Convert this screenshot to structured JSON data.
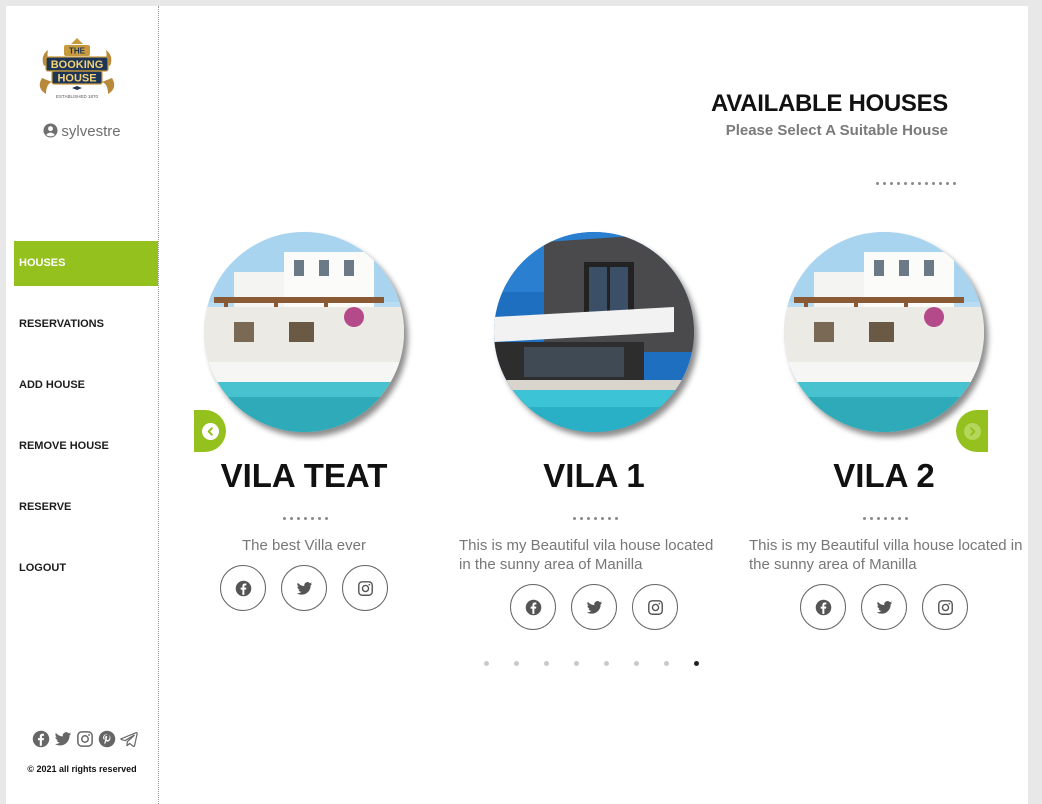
{
  "brand": {
    "logo_lines": [
      "THE",
      "BOOKING",
      "HOUSE",
      "ESTABLISHED 1870"
    ]
  },
  "user": {
    "name": "sylvestre",
    "icon": "user-circle-icon"
  },
  "nav": {
    "items": [
      {
        "label": "HOUSES",
        "active": true
      },
      {
        "label": "RESERVATIONS",
        "active": false
      },
      {
        "label": "ADD HOUSE",
        "active": false
      },
      {
        "label": "REMOVE HOUSE",
        "active": false
      },
      {
        "label": "RESERVE",
        "active": false
      },
      {
        "label": "LOGOUT",
        "active": false
      }
    ]
  },
  "footer": {
    "social_icons": [
      "facebook-icon",
      "twitter-icon",
      "instagram-icon",
      "pinterest-icon",
      "telegram-icon"
    ],
    "copyright": "© 2021 all rights reserved"
  },
  "main": {
    "title": "AVAILABLE HOUSES",
    "subtitle": "Please Select A Suitable House"
  },
  "houses": [
    {
      "name": "VILA TEAT",
      "description": "The best Villa ever",
      "photo": "white-villa-pool"
    },
    {
      "name": "VILA 1",
      "description": "This is my Beautiful vila house located in the sunny area of Manilla",
      "photo": "modern-grey-house-pool"
    },
    {
      "name": "VILA 2",
      "description": "This is my Beautiful villa house located in the sunny area of Manilla",
      "photo": "white-villa-pool"
    }
  ],
  "carousel": {
    "page_count": 8,
    "active_page": 8
  },
  "colors": {
    "accent": "#95c11f",
    "text": "#111111",
    "muted": "#777777"
  }
}
